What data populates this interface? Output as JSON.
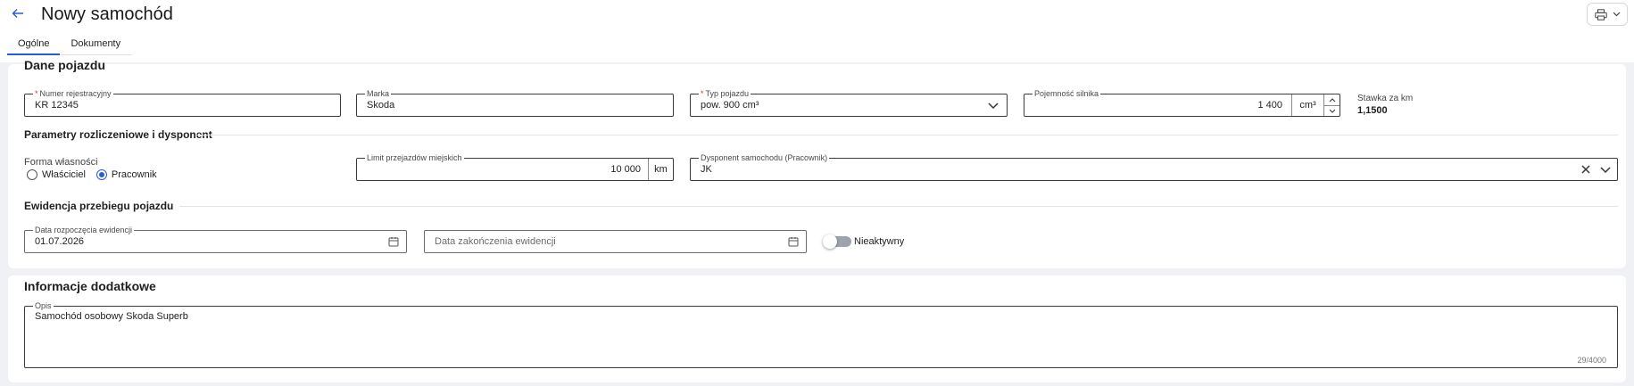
{
  "header": {
    "title": "Nowy samochód",
    "back_icon": "arrow-left-icon",
    "print_icon": "printer-icon"
  },
  "tabs": [
    {
      "label": "Ogólne",
      "active": true
    },
    {
      "label": "Dokumenty",
      "active": false
    }
  ],
  "vehicle": {
    "section_title": "Dane pojazdu",
    "registration": {
      "label": "Numer rejestracyjny",
      "required": true,
      "value": "KR 12345"
    },
    "brand": {
      "label": "Marka",
      "value": "Skoda"
    },
    "vehicle_type": {
      "label": "Typ pojazdu",
      "required": true,
      "value": "pow. 900 cm³"
    },
    "engine": {
      "label": "Pojemność silnika",
      "value": "1 400",
      "unit": "cm³"
    },
    "rate": {
      "label": "Stawka za km",
      "value": "1,1500"
    }
  },
  "settlement": {
    "title": "Parametry rozliczeniowe i dysponent",
    "ownership": {
      "label": "Forma własności",
      "options": [
        "Właściciel",
        "Pracownik"
      ],
      "selected": "Pracownik"
    },
    "city_limit": {
      "label": "Limit przejazdów miejskich",
      "value": "10 000",
      "unit": "km"
    },
    "disposer": {
      "label": "Dysponent samochodu (Pracownik)",
      "value": "JK"
    }
  },
  "mileage": {
    "title": "Ewidencja przebiegu pojazdu",
    "start_date": {
      "label": "Data rozpoczęcia ewidencji",
      "value": "01.07.2026"
    },
    "end_date": {
      "placeholder": "Data zakończenia ewidencji"
    },
    "inactive_toggle": {
      "label": "Nieaktywny",
      "checked": false
    }
  },
  "additional": {
    "section_title": "Informacje dodatkowe",
    "description": {
      "label": "Opis",
      "value": "Samochód osobowy Skoda Superb",
      "counter": "29/4000"
    }
  },
  "colors": {
    "accent": "#2a5bd7",
    "required": "#d32f2f",
    "background": "#f0f1f5"
  }
}
